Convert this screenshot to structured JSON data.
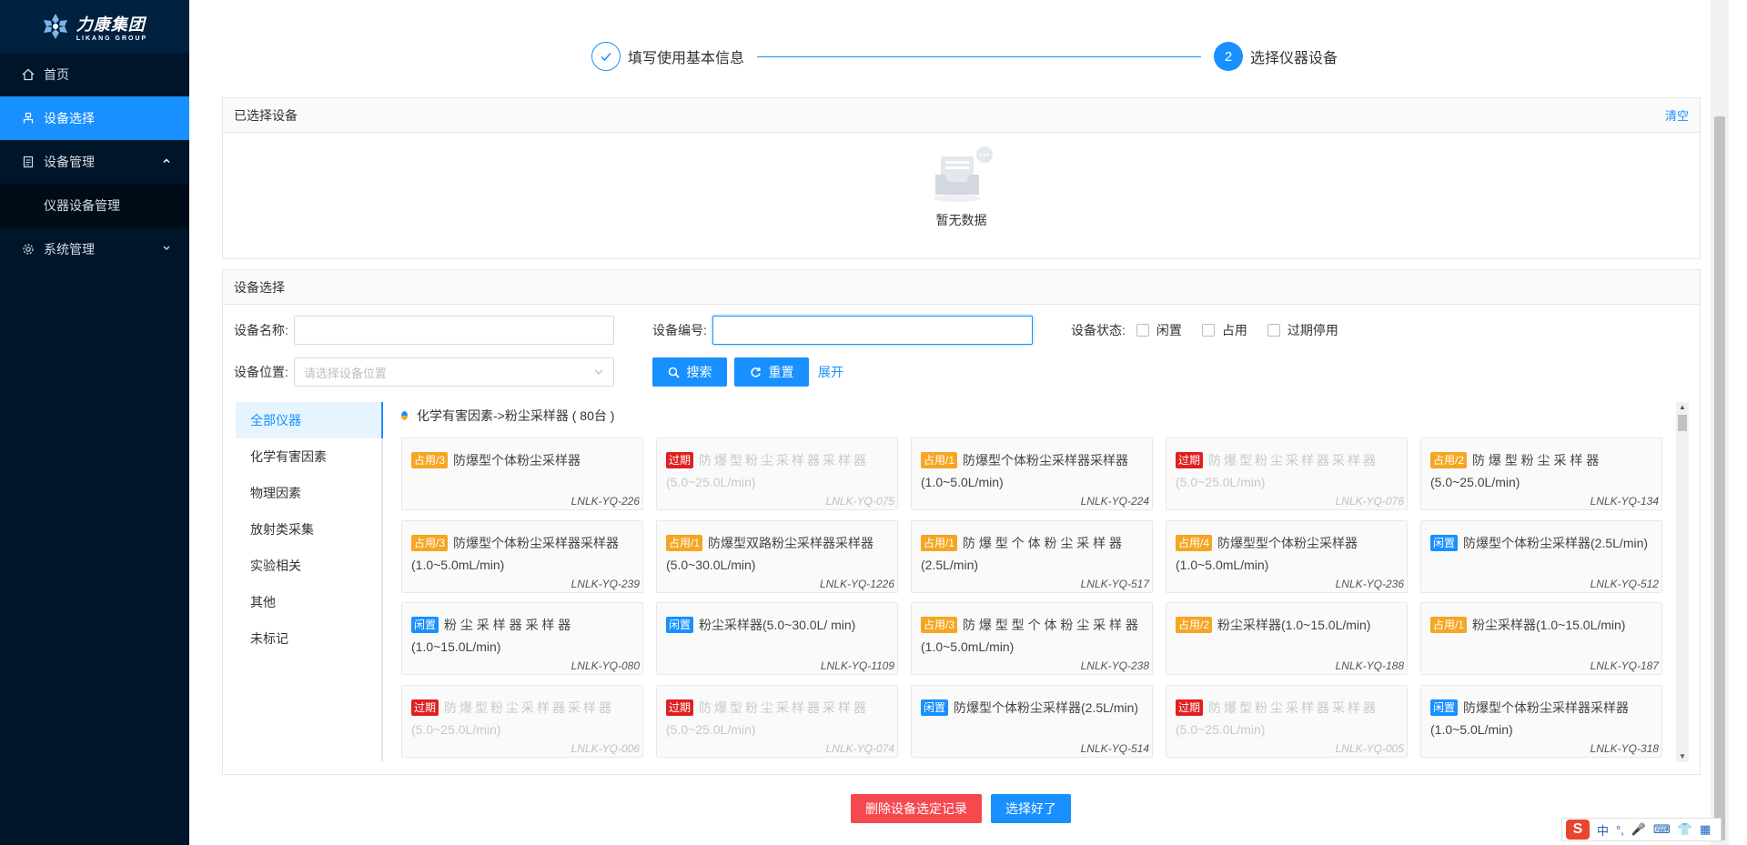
{
  "brand": {
    "name_cn": "力康集团",
    "name_en": "LIKANG GROUP"
  },
  "sidebar": {
    "items": [
      {
        "label": "首页",
        "icon": "home-icon"
      },
      {
        "label": "设备选择",
        "icon": "device-select-icon",
        "active": true
      },
      {
        "label": "设备管理",
        "icon": "clipboard-icon",
        "expanded": true
      },
      {
        "label": "系统管理",
        "icon": "gear-icon"
      }
    ],
    "submenu": [
      {
        "label": "仪器设备管理"
      }
    ]
  },
  "steps": [
    {
      "label": "填写使用基本信息",
      "status": "done"
    },
    {
      "label": "选择仪器设备",
      "number": "2",
      "status": "current"
    }
  ],
  "selected_panel": {
    "title": "已选择设备",
    "clear_label": "清空",
    "empty_text": "暂无数据"
  },
  "selection_panel": {
    "title": "设备选择",
    "filters": {
      "name_label": "设备名称:",
      "code_label": "设备编号:",
      "status_label": "设备状态:",
      "status_options": [
        "闲置",
        "占用",
        "过期停用"
      ],
      "location_label": "设备位置:",
      "location_placeholder": "请选择设备位置",
      "search_label": "搜索",
      "reset_label": "重置",
      "expand_label": "展开"
    },
    "categories": [
      "全部仪器",
      "化学有害因素",
      "物理因素",
      "放射类采集",
      "实验相关",
      "其他",
      "未标记"
    ],
    "active_category": 0,
    "breadcrumb": "化学有害因素->粉尘采样器 ( 80台 )",
    "devices": [
      {
        "tag": "占用/3",
        "status": "busy",
        "name": "防爆型个体粉尘采样器",
        "spec": "",
        "code": "LNLK-YQ-226"
      },
      {
        "tag": "过期",
        "status": "expired",
        "name": "防爆型粉尘采样器采样器",
        "spec": "(5.0~25.0L/min)",
        "code": "LNLK-YQ-075"
      },
      {
        "tag": "占用/1",
        "status": "busy",
        "name": "防爆型个体粉尘采样器采样器",
        "spec": "(1.0~5.0L/min)",
        "code": "LNLK-YQ-224"
      },
      {
        "tag": "过期",
        "status": "expired",
        "name": "防爆型粉尘采样器采样器",
        "spec": "(5.0~25.0L/min)",
        "code": "LNLK-YQ-076"
      },
      {
        "tag": "占用/2",
        "status": "busy",
        "name": "防 爆 型 粉 尘 采 样 器",
        "spec": "(5.0~25.0L/min)",
        "code": "LNLK-YQ-134"
      },
      {
        "tag": "占用/3",
        "status": "busy",
        "name": "防爆型个体粉尘采样器采样器",
        "spec": "(1.0~5.0mL/min)",
        "code": "LNLK-YQ-239"
      },
      {
        "tag": "占用/1",
        "status": "busy",
        "name": "防爆型双路粉尘采样器采样器",
        "spec": "(5.0~30.0L/min)",
        "code": "LNLK-YQ-1226"
      },
      {
        "tag": "占用/1",
        "status": "busy",
        "name": "防 爆 型 个 体 粉 尘 采 样 器",
        "spec": "(2.5L/min)",
        "code": "LNLK-YQ-517"
      },
      {
        "tag": "占用/4",
        "status": "busy",
        "name": "防爆型型个体粉尘采样器",
        "spec": "(1.0~5.0mL/min)",
        "code": "LNLK-YQ-236"
      },
      {
        "tag": "闲置",
        "status": "idle",
        "name": "防爆型个体粉尘采样器(2.5L/min)",
        "spec": "",
        "code": "LNLK-YQ-512"
      },
      {
        "tag": "闲置",
        "status": "idle",
        "name": "粉 尘 采 样 器 采 样 器",
        "spec": "(1.0~15.0L/min)",
        "code": "LNLK-YQ-080"
      },
      {
        "tag": "闲置",
        "status": "idle",
        "name": "粉尘采样器(5.0~30.0L/ min)",
        "spec": "",
        "code": "LNLK-YQ-1109"
      },
      {
        "tag": "占用/3",
        "status": "busy",
        "name": "防 爆 型 型 个 体 粉 尘 采 样 器",
        "spec": "(1.0~5.0mL/min)",
        "code": "LNLK-YQ-238"
      },
      {
        "tag": "占用/2",
        "status": "busy",
        "name": "粉尘采样器(1.0~15.0L/min)",
        "spec": "",
        "code": "LNLK-YQ-188"
      },
      {
        "tag": "占用/1",
        "status": "busy",
        "name": "粉尘采样器(1.0~15.0L/min)",
        "spec": "",
        "code": "LNLK-YQ-187"
      },
      {
        "tag": "过期",
        "status": "expired",
        "name": "防爆型粉尘采样器采样器",
        "spec": "(5.0~25.0L/min)",
        "code": "LNLK-YQ-006"
      },
      {
        "tag": "过期",
        "status": "expired",
        "name": "防爆型粉尘采样器采样器",
        "spec": "(5.0~25.0L/min)",
        "code": "LNLK-YQ-074"
      },
      {
        "tag": "闲置",
        "status": "idle",
        "name": "防爆型个体粉尘采样器(2.5L/min)",
        "spec": "",
        "code": "LNLK-YQ-514"
      },
      {
        "tag": "过期",
        "status": "expired",
        "name": "防爆型粉尘采样器采样器",
        "spec": "(5.0~25.0L/min)",
        "code": "LNLK-YQ-005"
      },
      {
        "tag": "闲置",
        "status": "idle",
        "name": "防爆型个体粉尘采样器采样器",
        "spec": "(1.0~5.0L/min)",
        "code": "LNLK-YQ-318"
      }
    ]
  },
  "footer": {
    "delete_label": "删除设备选定记录",
    "confirm_label": "选择好了"
  },
  "ime": {
    "lang": "中",
    "punct": "°,"
  },
  "colors": {
    "primary": "#1890ff",
    "sidebar_bg": "#001529",
    "busy": "#f5a623",
    "expired": "#e02020",
    "danger": "#f5484f"
  }
}
